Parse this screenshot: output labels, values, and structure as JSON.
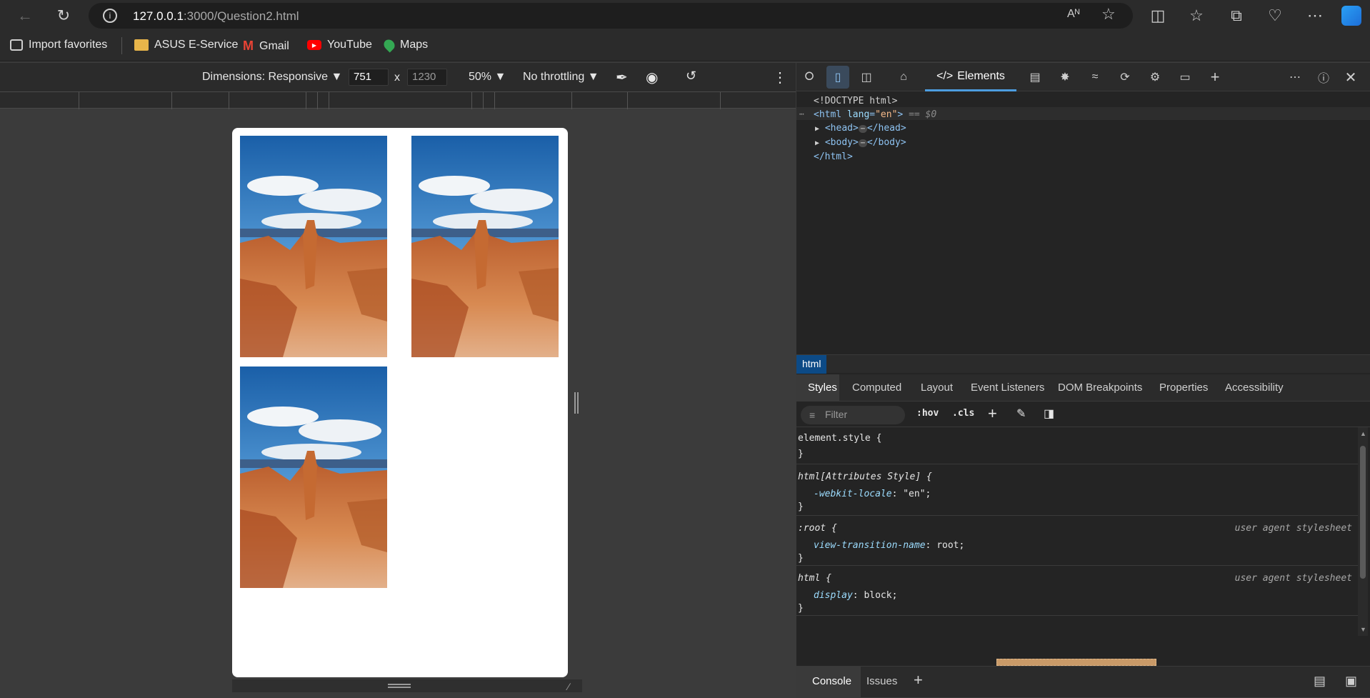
{
  "browser": {
    "url_host": "127.0.0.1",
    "url_rest": ":3000/Question2.html",
    "bookmarks": [
      {
        "label": "Import favorites",
        "icon": "import-icon"
      },
      {
        "label": "ASUS E-Service",
        "icon": "folder-icon"
      },
      {
        "label": "Gmail",
        "icon": "gmail-icon"
      },
      {
        "label": "YouTube",
        "icon": "youtube-icon"
      },
      {
        "label": "Maps",
        "icon": "maps-icon"
      }
    ]
  },
  "device_toolbar": {
    "dimensions_label": "Dimensions: Responsive",
    "width": "751",
    "height": "1230",
    "times": "x",
    "zoom": "50%",
    "throttling": "No throttling"
  },
  "devtools": {
    "elements_tab": "Elements",
    "dom": {
      "doctype": "<!DOCTYPE html>",
      "html_open": "<html",
      "lang_attr": "lang",
      "lang_val": "\"en\"",
      "gt": ">",
      "selected_marker": "== $0",
      "head_open": "<head>",
      "head_close": "</head>",
      "body_open": "<body>",
      "body_close": "</body>",
      "html_close": "</html>"
    },
    "breadcrumb": "html",
    "style_tabs": [
      "Styles",
      "Computed",
      "Layout",
      "Event Listeners",
      "DOM Breakpoints",
      "Properties",
      "Accessibility"
    ],
    "filter_placeholder": "Filter",
    "hov": ":hov",
    "cls": ".cls",
    "rules": {
      "r1_selector": "element.style {",
      "r1_close": "}",
      "r2_selector": "html[Attributes Style] {",
      "r2_prop": "-webkit-locale",
      "r2_val": ": \"en\";",
      "r2_close": "}",
      "r3_selector": ":root {",
      "r3_source": "user agent stylesheet",
      "r3_prop": "view-transition-name",
      "r3_val": ": root;",
      "r3_close": "}",
      "r4_selector": "html {",
      "r4_source": "user agent stylesheet",
      "r4_prop": "display",
      "r4_val": ": block;",
      "r4_close": "}"
    },
    "drawer_tabs": [
      "Console",
      "Issues"
    ]
  },
  "colors": {
    "accent": "#4d9de0",
    "breadcrumb_bg": "#0c4a86"
  }
}
